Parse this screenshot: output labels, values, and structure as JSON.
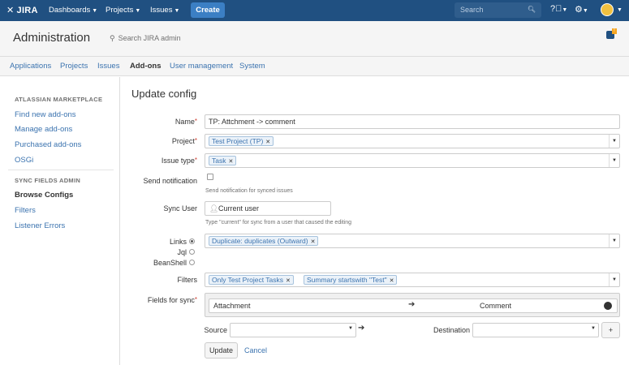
{
  "topnav": {
    "logo": "JIRA",
    "menus": [
      "Dashboards",
      "Projects",
      "Issues"
    ],
    "create": "Create",
    "search_placeholder": "Search"
  },
  "admin": {
    "title": "Administration",
    "search": "Search JIRA admin",
    "tabs": [
      "Applications",
      "Projects",
      "Issues",
      "Add-ons",
      "User management",
      "System"
    ],
    "active_tab": "Add-ons"
  },
  "sidebar": {
    "section1": "ATLASSIAN MARKETPLACE",
    "items1": [
      "Find new add-ons",
      "Manage add-ons",
      "Purchased add-ons",
      "OSGi"
    ],
    "section2": "SYNC FIELDS ADMIN",
    "items2": [
      "Browse Configs",
      "Filters",
      "Listener Errors"
    ],
    "active": "Browse Configs"
  },
  "form": {
    "title": "Update config",
    "name_label": "Name",
    "name_value": "TP: Attchment -> comment",
    "project_label": "Project",
    "project_chip": "Test Project (TP)",
    "issuetype_label": "Issue type",
    "issuetype_chip": "Task",
    "notify_label": "Send notification",
    "notify_hint": "Send notification for synced issues",
    "syncuser_label": "Sync User",
    "syncuser_value": "Current user",
    "syncuser_hint": "Type \"current\" for sync from a user that caused the editing",
    "links_label": "Links",
    "jql_label": "Jql",
    "beanshell_label": "BeanShell",
    "links_chip": "Duplicate: duplicates (Outward)",
    "filters_label": "Filters",
    "filter_chips": [
      "Only Test Project Tasks",
      "Summary startswith \"Test\""
    ],
    "fields_label": "Fields for sync",
    "sync_source": "Attachment",
    "sync_dest": "Comment",
    "source_label": "Source",
    "destination_label": "Destination",
    "update_button": "Update",
    "cancel_link": "Cancel"
  }
}
